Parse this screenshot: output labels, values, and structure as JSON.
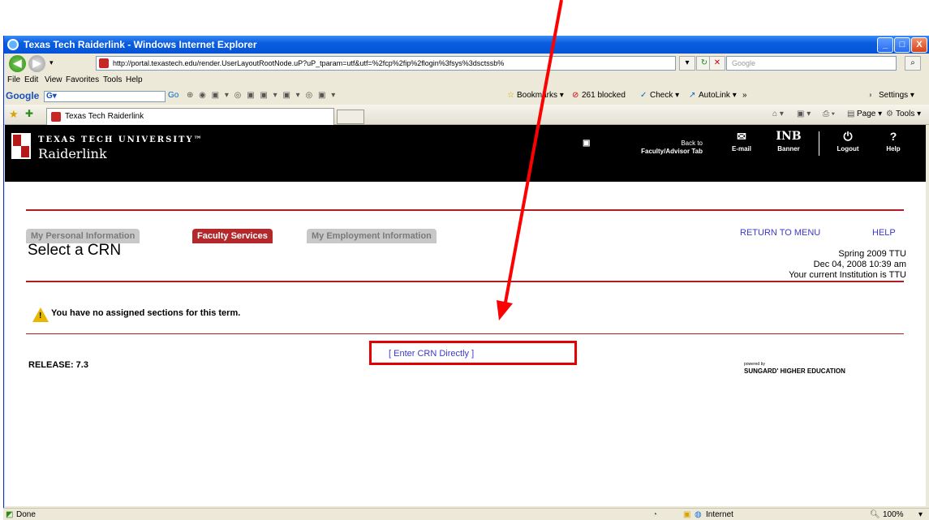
{
  "window": {
    "title": "Texas Tech Raiderlink - Windows Internet Explorer",
    "minimize_glyph": "_",
    "maximize_glyph": "□",
    "close_glyph": "X"
  },
  "address_bar": {
    "url": "http://portal.texastech.edu/render.UserLayoutRootNode.uP?uP_tparam=utf&utf=%2fcp%2fip%2flogin%3fsys%3dsctssb%",
    "search_placeholder": "Google",
    "refresh_glyph": "↻",
    "stop_glyph": "✕",
    "search_glyph": "⌕"
  },
  "menu": {
    "items": [
      "File",
      "Edit",
      "View",
      "Favorites",
      "Tools",
      "Help"
    ]
  },
  "google_toolbar": {
    "brand": "Google",
    "search_label": "G▾",
    "go_label": "Go",
    "bookmarks_label": "Bookmarks ▾",
    "blocked_label": "261 blocked",
    "check_label": "Check ▾",
    "autolink_label": "AutoLink ▾",
    "more_label": "»",
    "settings_label": "Settings ▾"
  },
  "tab_bar": {
    "tab_title": "Texas Tech Raiderlink",
    "page_label": "Page ▾",
    "tools_label": "Tools ▾"
  },
  "banner": {
    "university": "TEXAS TECH UNIVERSITY™",
    "portal_name": "Raiderlink",
    "back_to": "Back to",
    "faculty_tab": "Faculty/Advisor Tab",
    "email": "E-mail",
    "inb": "INB",
    "banner_label": "Banner",
    "logout": "Logout",
    "help": "Help"
  },
  "nav_tabs": [
    {
      "label": "My Personal Information",
      "active": false
    },
    {
      "label": "Faculty Services",
      "active": true
    },
    {
      "label": "My Employment Information",
      "active": false
    }
  ],
  "page": {
    "return_to_menu": "RETURN TO MENU",
    "help": "HELP",
    "title": "Select a CRN",
    "term": "Spring 2009 TTU",
    "datetime": "Dec 04, 2008 10:39 am",
    "institution": "Your current Institution is TTU",
    "warning": "You have no assigned sections for this term.",
    "enter_crn": "[ Enter CRN Directly ]",
    "release": "RELEASE: 7.3",
    "powered_by": "powered by",
    "vendor": "SUNGARD' HIGHER EDUCATION"
  },
  "status_bar": {
    "status": "Done",
    "zone": "Internet",
    "zoom": "100%"
  },
  "annotation": {
    "arrow_color": "#ff0000",
    "box_color": "#e30000"
  }
}
